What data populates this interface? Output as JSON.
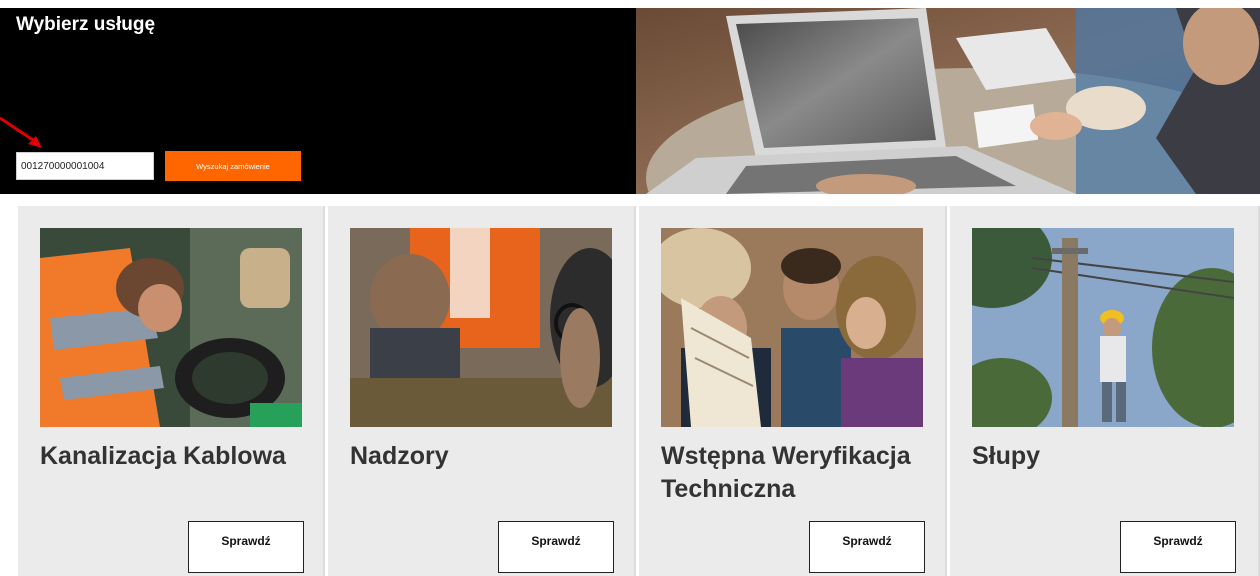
{
  "hero": {
    "title": "Wybierz usługę",
    "search_value": "001270000001004",
    "search_button_label": "Wyszukaj zamówienie"
  },
  "cards": [
    {
      "title": "Kanalizacja Kablowa",
      "button_label": "Sprawdź"
    },
    {
      "title": "Nadzory",
      "button_label": "Sprawdź"
    },
    {
      "title": "Wstępna Weryfikacja Techniczna",
      "button_label": "Sprawdź"
    },
    {
      "title": "Słupy",
      "button_label": "Sprawdź"
    }
  ],
  "colors": {
    "accent": "#ff6600",
    "hero_background": "#000000",
    "card_background": "#ebebeb",
    "annotation_arrow": "#e00000"
  },
  "icons": {
    "annotation": "red-arrow-icon"
  }
}
